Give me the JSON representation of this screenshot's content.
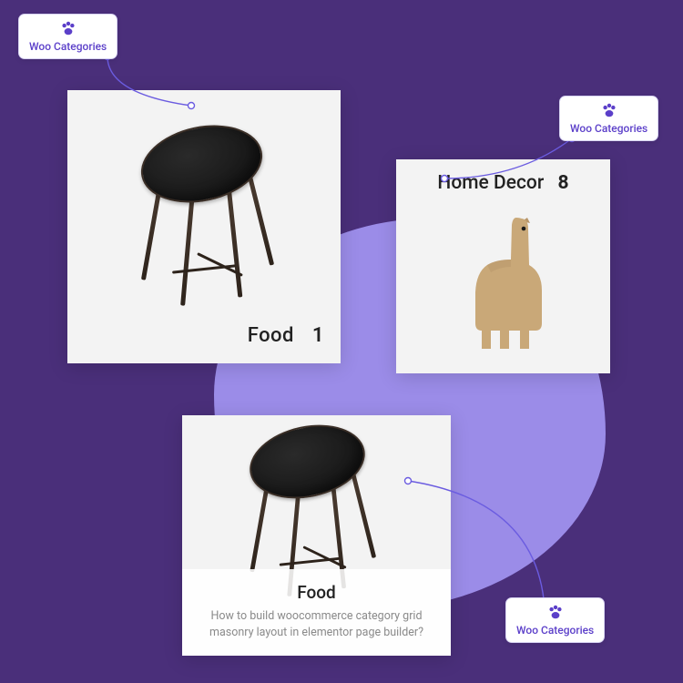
{
  "tags": {
    "tag1": "Woo Categories",
    "tag2": "Woo Categories",
    "tag3": "Woo Categories"
  },
  "card1": {
    "title": "Food",
    "count": "1"
  },
  "card2": {
    "title": "Home Decor",
    "count": "8"
  },
  "card3": {
    "title": "Food",
    "description": "How to build woocommerce category grid masonry layout in elementor page builder?"
  },
  "colors": {
    "background": "#4a2f7a",
    "blob": "#9b8ce8",
    "accent": "#5b3fc9"
  }
}
